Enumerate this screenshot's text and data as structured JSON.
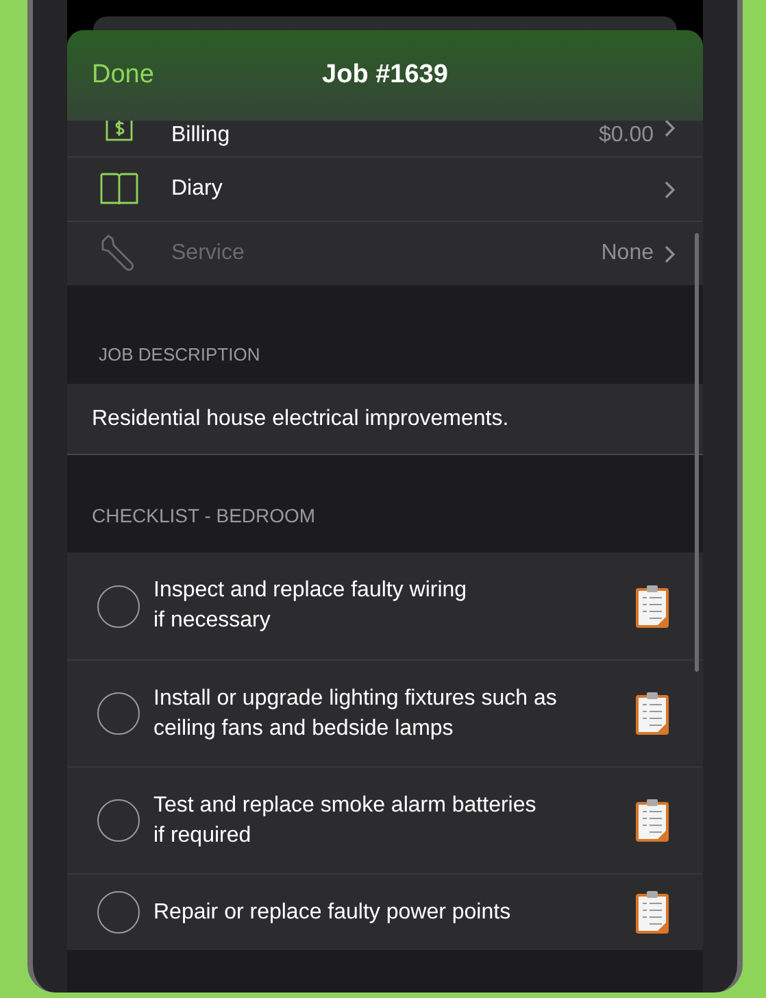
{
  "header": {
    "done": "Done",
    "title": "Job #1639"
  },
  "menu": [
    {
      "kind": "billing",
      "label": "Billing",
      "value": "$0.00",
      "disabled": false
    },
    {
      "kind": "diary",
      "label": "Diary",
      "disabled": false
    },
    {
      "kind": "service",
      "label": "Service",
      "value": "None",
      "disabled": true
    }
  ],
  "job_description": {
    "heading": "JOB DESCRIPTION",
    "text": "Residential house electrical improvements."
  },
  "checklist": {
    "heading": "CHECKLIST - BEDROOM",
    "items": [
      {
        "line1": "Inspect and replace faulty wiring",
        "line2": "if necessary",
        "checked": false
      },
      {
        "line1": "Install or upgrade lighting fixtures such as",
        "line2": "ceiling fans and bedside lamps",
        "checked": false
      },
      {
        "line1": "Test and replace smoke alarm batteries",
        "line2": "if required",
        "checked": false
      },
      {
        "line1": "Repair or replace faulty power points",
        "checked": false
      }
    ]
  }
}
